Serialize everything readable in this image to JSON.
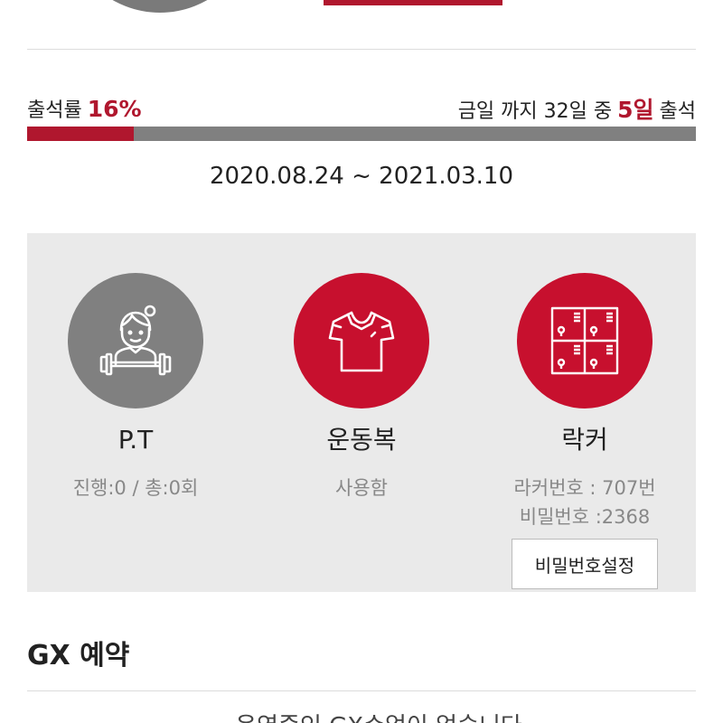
{
  "attendance": {
    "label": "출석률",
    "rate": "16%",
    "rate_fraction": 0.16,
    "summary_prefix": "금일 까지 32일 중",
    "attended_days": "5일",
    "summary_suffix": "출석"
  },
  "membership": {
    "period": "2020.08.24 ~ 2021.03.10"
  },
  "services": {
    "pt": {
      "title": "P.T",
      "detail": "진행:0 / 총:0회",
      "icon": "trainer-icon"
    },
    "sportswear": {
      "title": "운동복",
      "detail": "사용함",
      "icon": "tshirt-icon"
    },
    "locker": {
      "title": "락커",
      "number": "라커번호 : 707번",
      "password": "비밀번호 :2368",
      "set_password_label": "비밀번호설정",
      "icon": "locker-icon"
    }
  },
  "gx": {
    "title": "GX 예약",
    "empty_message": "운영중인 GX수업이 없습니다"
  },
  "colors": {
    "accent": "#b0172e",
    "icon_red": "#c7102e",
    "icon_gray": "#808080",
    "panel": "#eaeaea"
  }
}
